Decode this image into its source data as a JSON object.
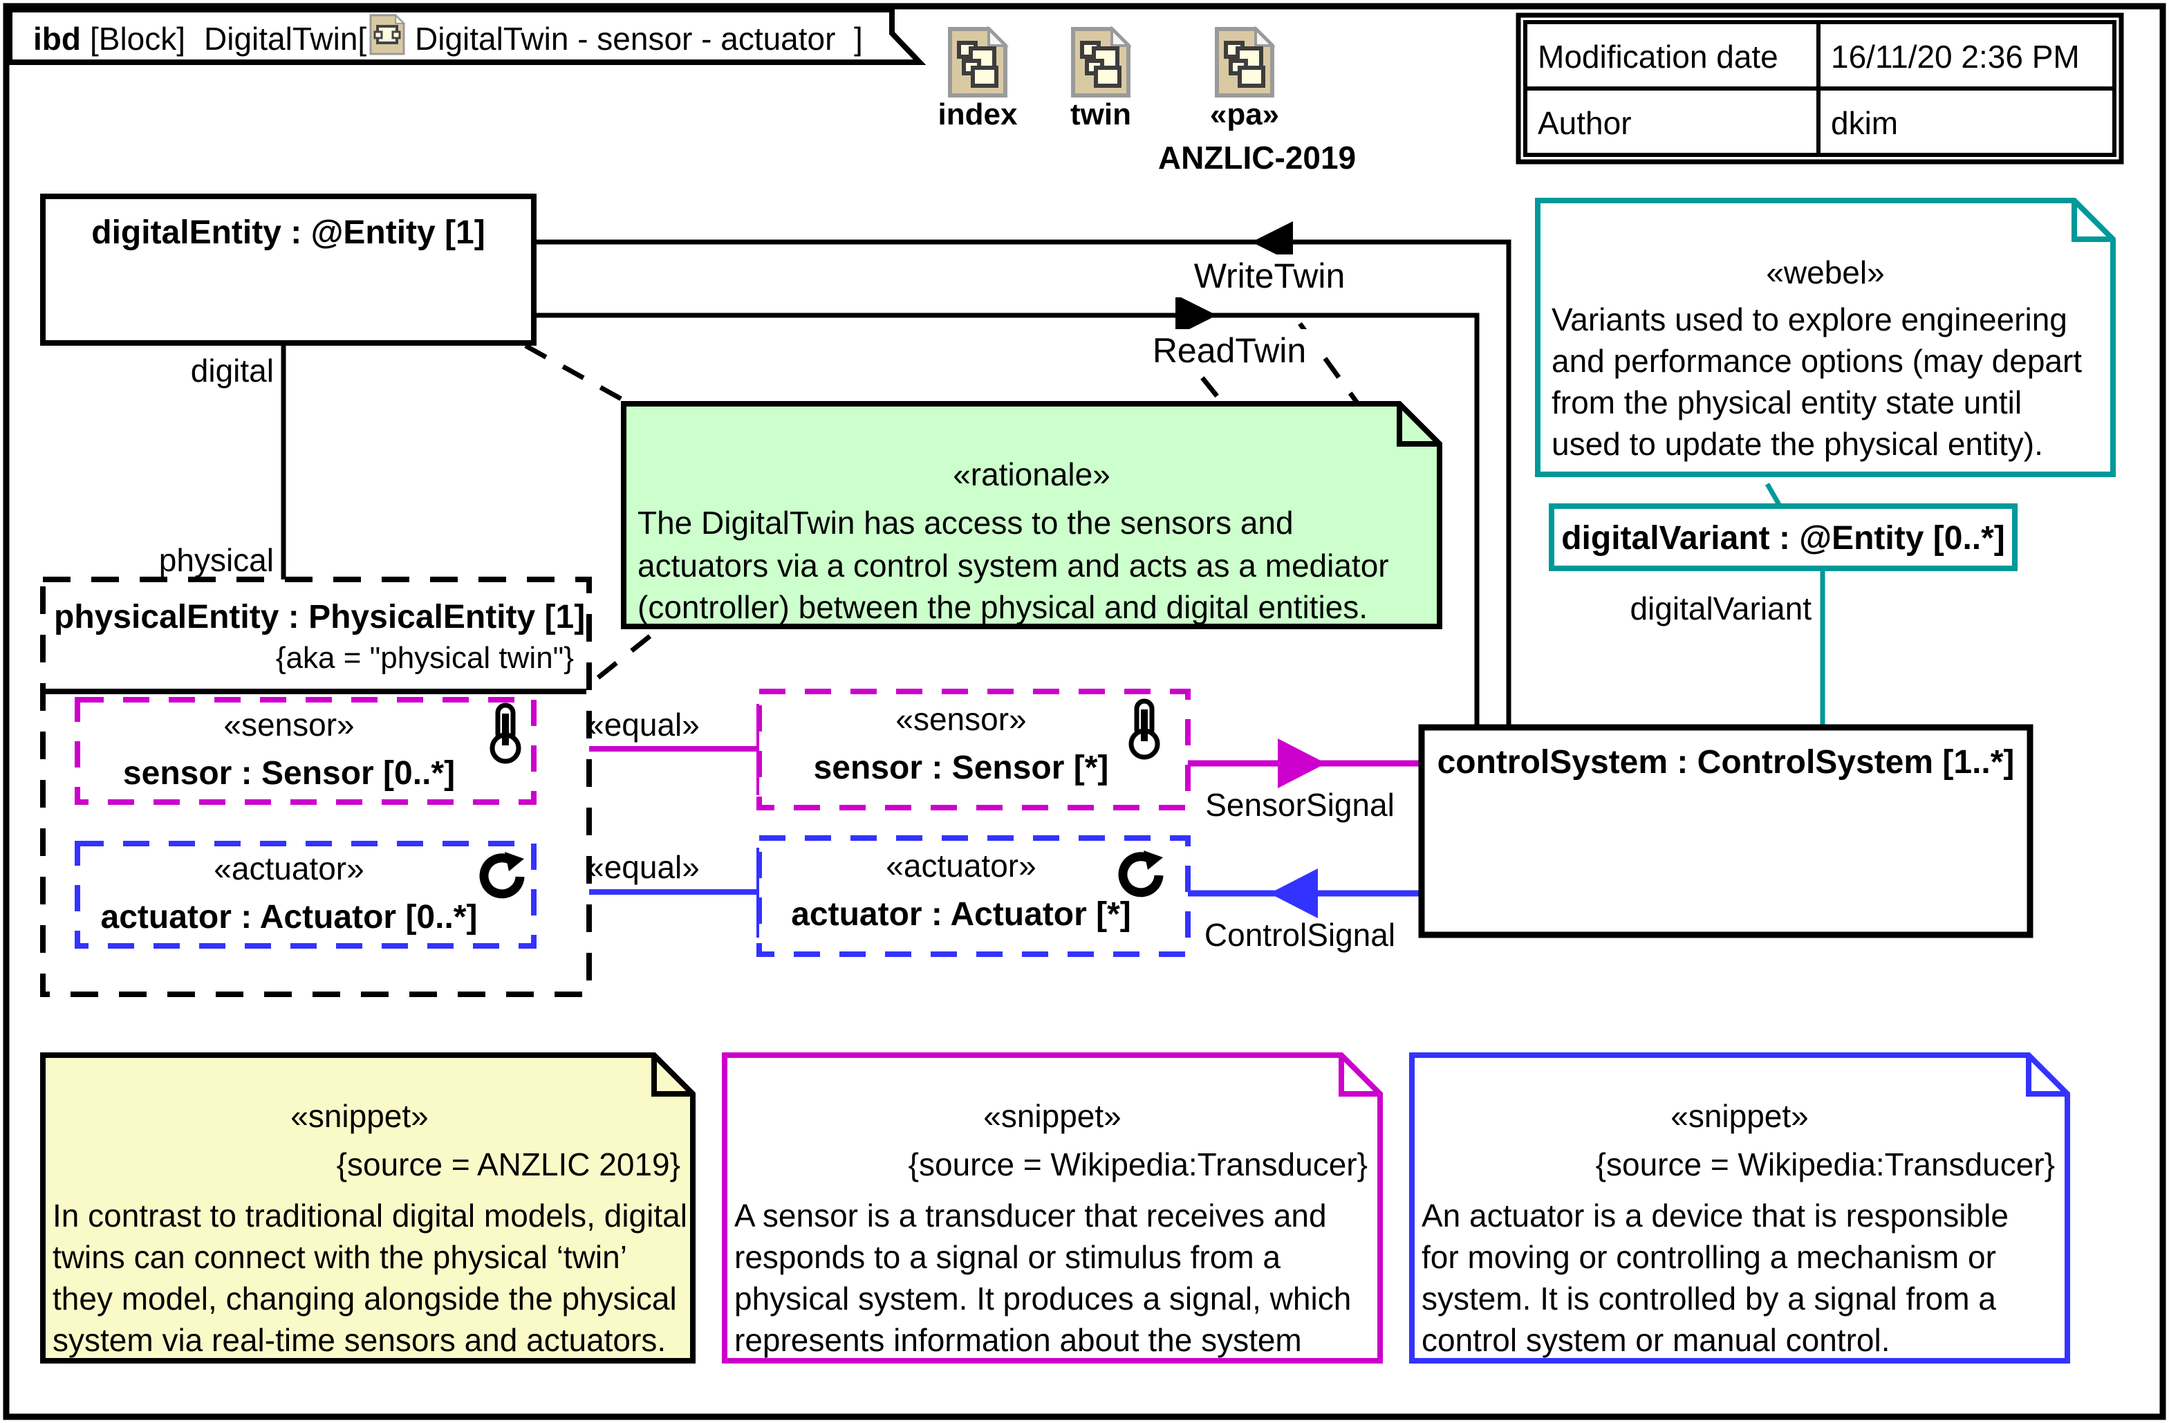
{
  "diagram": {
    "header": {
      "kind": "ibd",
      "block_keyword": "[Block]",
      "block_name": "DigitalTwin[",
      "view_name": "DigitalTwin - sensor - actuator",
      "close_bracket": "]",
      "frame_icon": "ibd-frame-icon"
    },
    "icon_row": [
      {
        "label": "index",
        "icon": "document-icon"
      },
      {
        "label": "twin",
        "icon": "document-icon"
      },
      {
        "label": "«pa»",
        "icon": "document-icon"
      }
    ],
    "icon_row_caption": "ANZLIC-2019",
    "metadata": {
      "rows": [
        {
          "key": "Modification date",
          "value": "16/11/20 2:36 PM"
        },
        {
          "key": "Author",
          "value": "dkim"
        }
      ]
    },
    "parts": {
      "digital_entity": "digitalEntity : @Entity [1]",
      "physical_entity": "physicalEntity : PhysicalEntity [1]",
      "physical_entity_constraint": "{aka = \"physical twin\"}",
      "control_system": "controlSystem : ControlSystem [1..*]",
      "digital_variant": "digitalVariant : @Entity [0..*]",
      "sensor_left": {
        "stereotype": "«sensor»",
        "name": "sensor : Sensor [0..*]",
        "icon": "thermometer-icon"
      },
      "actuator_left": {
        "stereotype": "«actuator»",
        "name": "actuator : Actuator [0..*]",
        "icon": "rotation-icon"
      },
      "sensor_right": {
        "stereotype": "«sensor»",
        "name": "sensor : Sensor [*]",
        "icon": "thermometer-icon"
      },
      "actuator_right": {
        "stereotype": "«actuator»",
        "name": "actuator : Actuator [*]",
        "icon": "rotation-icon"
      }
    },
    "connector_labels": {
      "digital": "digital",
      "physical": "physical",
      "write_twin": "WriteTwin",
      "read_twin": "ReadTwin",
      "sensor_signal": "SensorSignal",
      "control_signal": "ControlSignal",
      "equal_sensor": "«equal»",
      "equal_actuator": "«equal»",
      "digital_variant_role": "digitalVariant"
    },
    "notes": {
      "rationale": {
        "stereotype": "«rationale»",
        "lines": [
          "The DigitalTwin has access to the sensors and",
          "actuators via a control system and acts as a mediator",
          "(controller) between the physical and digital entities."
        ],
        "fill": "#CCFFCC",
        "stroke": "#000000"
      },
      "webel": {
        "stereotype": "«webel»",
        "lines": [
          "Variants used to explore engineering",
          "and performance options (may depart",
          "from the physical entity state until",
          "used to update the physical entity)."
        ],
        "fill": "#FFFFFF",
        "stroke": "#009999"
      },
      "snippet_anzlic": {
        "stereotype": "«snippet»",
        "source": "{source = ANZLIC 2019}",
        "lines": [
          "In contrast to traditional digital models, digital",
          "twins can connect with the physical ‘twin’",
          "they model, changing alongside the physical",
          "system via real-time sensors and actuators."
        ],
        "fill": "#FAFAC8",
        "stroke": "#000000"
      },
      "snippet_sensor": {
        "stereotype": "«snippet»",
        "source": "{source = Wikipedia:Transducer}",
        "lines": [
          "A sensor is a transducer that receives and",
          "responds to a signal or stimulus from a",
          "physical system. It produces a signal, which",
          "represents information about the system"
        ],
        "fill": "#FFFFFF",
        "stroke": "#CC00CC"
      },
      "snippet_actuator": {
        "stereotype": "«snippet»",
        "source": "{source = Wikipedia:Transducer}",
        "lines": [
          "An actuator is a device that is responsible",
          "for moving or controlling a mechanism or",
          "system. It is controlled by a signal from a",
          "control system or manual control."
        ],
        "fill": "#FFFFFF",
        "stroke": "#3333FF"
      }
    },
    "colors": {
      "sensor": "#CC00CC",
      "actuator": "#3333FF",
      "variant": "#009999",
      "note_green": "#CCFFCC",
      "note_yellow": "#FAFAC8",
      "icon_fill": "#D9C9A3",
      "icon_inner": "#FFFCE0",
      "black": "#000000"
    }
  }
}
